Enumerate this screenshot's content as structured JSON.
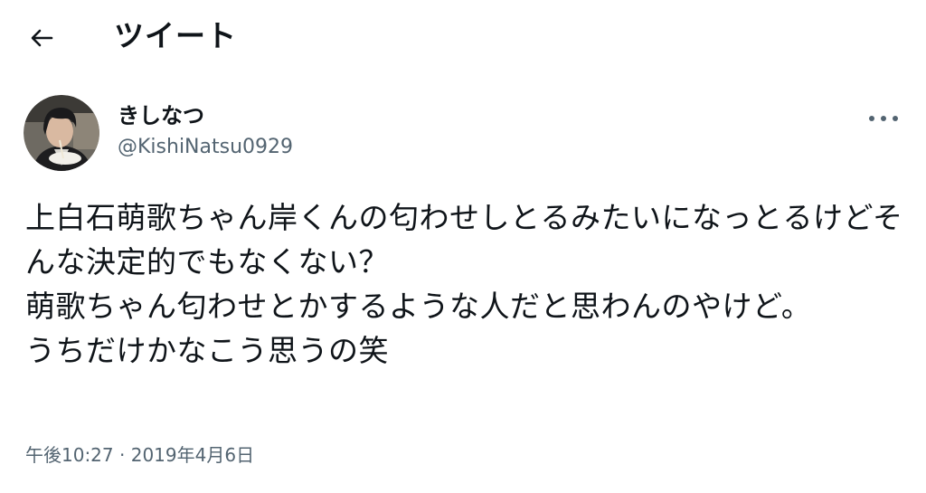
{
  "header": {
    "back_icon": "arrow-left-icon",
    "title": "ツイート"
  },
  "author": {
    "display_name": "きしなつ",
    "username": "@KishiNatsu0929",
    "avatar_icon": "user-avatar"
  },
  "more_icon": "more-horizontal-icon",
  "tweet": {
    "text": "上白石萌歌ちゃん岸くんの匂わせしとるみたいになっとるけどそんな決定的でもなくない？\n萌歌ちゃん匂わせとかするような人だと思わんのやけど。\nうちだけかなこう思うの笑"
  },
  "meta": {
    "time": "午後10:27",
    "separator": "·",
    "date": "2019年4月6日"
  },
  "colors": {
    "text_primary": "#0f1419",
    "text_secondary": "#536471",
    "background": "#ffffff"
  }
}
